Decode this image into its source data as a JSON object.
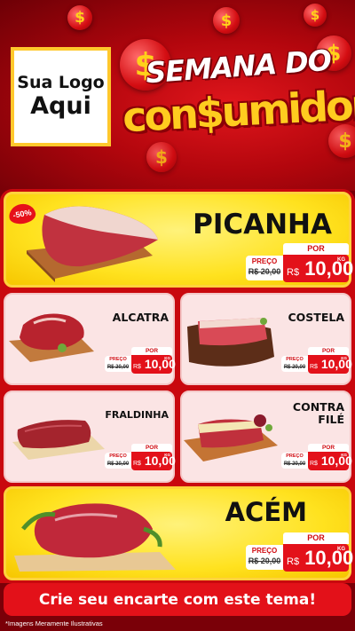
{
  "header": {
    "logo_line1": "Sua Logo",
    "logo_line2": "Aqui",
    "title_line1": "SEMANA DO",
    "title_line2": "con$umidor",
    "coin_symbol": "$"
  },
  "featured_badge": "-50%",
  "products": [
    {
      "name": "PICANHA",
      "por": "POR",
      "preco_label": "PREÇO",
      "old_price": "R$ 20,00",
      "currency": "R$",
      "price": "10,00",
      "unit": "KG"
    },
    {
      "name": "ALCATRA",
      "por": "POR",
      "preco_label": "PREÇO",
      "old_price": "R$ 20,00",
      "currency": "R$",
      "price": "10,00",
      "unit": "KG"
    },
    {
      "name": "COSTELA",
      "por": "POR",
      "preco_label": "PREÇO",
      "old_price": "R$ 20,00",
      "currency": "R$",
      "price": "10,00",
      "unit": "KG"
    },
    {
      "name": "FRALDINHA",
      "por": "POR",
      "preco_label": "PREÇO",
      "old_price": "R$ 20,00",
      "currency": "R$",
      "price": "10,00",
      "unit": "KG"
    },
    {
      "name_line1": "CONTRA",
      "name_line2": "FILÉ",
      "por": "POR",
      "preco_label": "PREÇO",
      "old_price": "R$ 20,00",
      "currency": "R$",
      "price": "10,00",
      "unit": "KG"
    },
    {
      "name": "ACÉM",
      "por": "POR",
      "preco_label": "PREÇO",
      "old_price": "R$ 20,00",
      "currency": "R$",
      "price": "10,00",
      "unit": "KG"
    }
  ],
  "footer": {
    "cta": "Crie seu encarte com este tema!",
    "disclaimer": "*Imagens Meramente Ilustrativas"
  },
  "colors": {
    "red": "#e3111a",
    "yellow": "#ffe21f",
    "dark_red": "#7a0008",
    "pink_card": "#fbe4e4"
  }
}
